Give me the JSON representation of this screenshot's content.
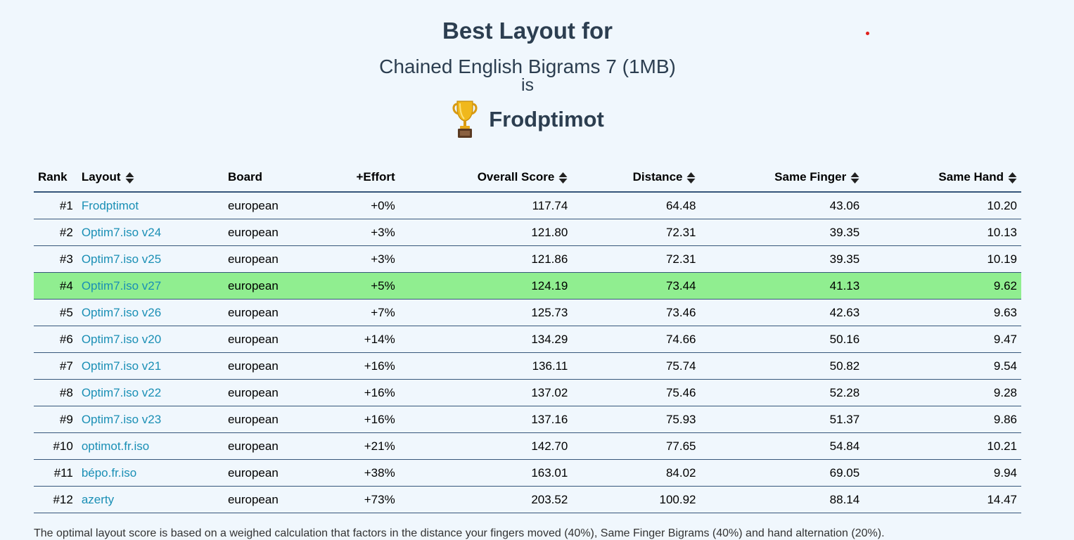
{
  "header": {
    "title": "Best Layout for",
    "corpus": "Chained English Bigrams 7 (1MB)",
    "is_word": "is",
    "winner": "Frodptimot"
  },
  "table": {
    "columns": {
      "rank": "Rank",
      "layout": "Layout",
      "board": "Board",
      "effort": "+Effort",
      "overall": "Overall Score",
      "distance": "Distance",
      "same_finger": "Same Finger",
      "same_hand": "Same Hand"
    },
    "rows": [
      {
        "rank": "#1",
        "layout": "Frodptimot",
        "board": "european",
        "effort": "+0%",
        "overall": "117.74",
        "distance": "64.48",
        "same_finger": "43.06",
        "same_hand": "10.20",
        "highlighted": false
      },
      {
        "rank": "#2",
        "layout": "Optim7.iso v24",
        "board": "european",
        "effort": "+3%",
        "overall": "121.80",
        "distance": "72.31",
        "same_finger": "39.35",
        "same_hand": "10.13",
        "highlighted": false
      },
      {
        "rank": "#3",
        "layout": "Optim7.iso v25",
        "board": "european",
        "effort": "+3%",
        "overall": "121.86",
        "distance": "72.31",
        "same_finger": "39.35",
        "same_hand": "10.19",
        "highlighted": false
      },
      {
        "rank": "#4",
        "layout": "Optim7.iso v27",
        "board": "european",
        "effort": "+5%",
        "overall": "124.19",
        "distance": "73.44",
        "same_finger": "41.13",
        "same_hand": "9.62",
        "highlighted": true
      },
      {
        "rank": "#5",
        "layout": "Optim7.iso v26",
        "board": "european",
        "effort": "+7%",
        "overall": "125.73",
        "distance": "73.46",
        "same_finger": "42.63",
        "same_hand": "9.63",
        "highlighted": false
      },
      {
        "rank": "#6",
        "layout": "Optim7.iso v20",
        "board": "european",
        "effort": "+14%",
        "overall": "134.29",
        "distance": "74.66",
        "same_finger": "50.16",
        "same_hand": "9.47",
        "highlighted": false
      },
      {
        "rank": "#7",
        "layout": "Optim7.iso v21",
        "board": "european",
        "effort": "+16%",
        "overall": "136.11",
        "distance": "75.74",
        "same_finger": "50.82",
        "same_hand": "9.54",
        "highlighted": false
      },
      {
        "rank": "#8",
        "layout": "Optim7.iso v22",
        "board": "european",
        "effort": "+16%",
        "overall": "137.02",
        "distance": "75.46",
        "same_finger": "52.28",
        "same_hand": "9.28",
        "highlighted": false
      },
      {
        "rank": "#9",
        "layout": "Optim7.iso v23",
        "board": "european",
        "effort": "+16%",
        "overall": "137.16",
        "distance": "75.93",
        "same_finger": "51.37",
        "same_hand": "9.86",
        "highlighted": false
      },
      {
        "rank": "#10",
        "layout": "optimot.fr.iso",
        "board": "european",
        "effort": "+21%",
        "overall": "142.70",
        "distance": "77.65",
        "same_finger": "54.84",
        "same_hand": "10.21",
        "highlighted": false
      },
      {
        "rank": "#11",
        "layout": "bépo.fr.iso",
        "board": "european",
        "effort": "+38%",
        "overall": "163.01",
        "distance": "84.02",
        "same_finger": "69.05",
        "same_hand": "9.94",
        "highlighted": false
      },
      {
        "rank": "#12",
        "layout": "azerty",
        "board": "european",
        "effort": "+73%",
        "overall": "203.52",
        "distance": "100.92",
        "same_finger": "88.14",
        "same_hand": "14.47",
        "highlighted": false
      }
    ]
  },
  "footnote": "The optimal layout score is based on a weighed calculation that factors in the distance your fingers moved (40%), Same Finger Bigrams (40%) and hand alternation (20%).",
  "icons": {
    "trophy": "trophy-icon",
    "sort": "sort-icon"
  },
  "colors": {
    "background": "#f0f7fd",
    "heading": "#2c3e50",
    "link": "#1a8fb5",
    "highlight_row": "#90ee90",
    "rule": "#36567a"
  }
}
